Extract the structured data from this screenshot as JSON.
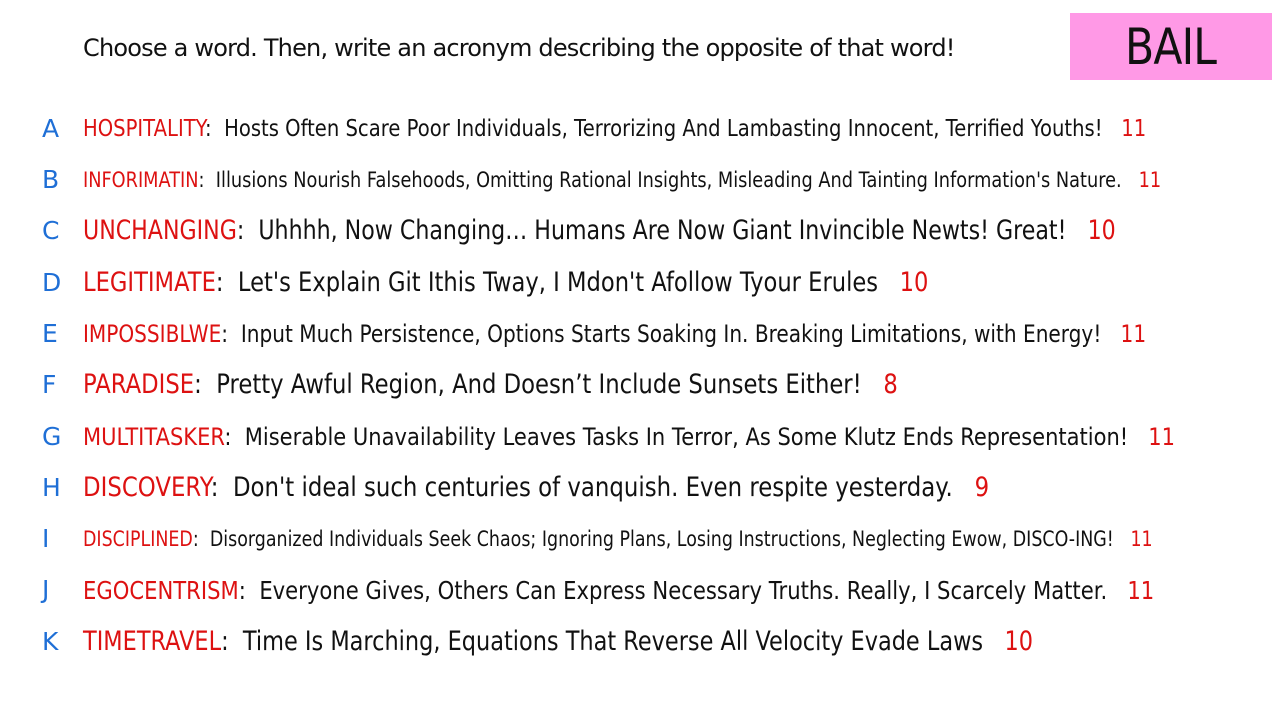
{
  "prompt": "Choose a word. Then, write an acronym describing the opposite of that word!",
  "badge": "BAIL",
  "colors": {
    "letter": "#1f6fd6",
    "word": "#dd1111",
    "count": "#dd1111",
    "badge_bg": "#ff99e6"
  },
  "entries": [
    {
      "letter": "A",
      "word": "HOSPITALITY",
      "acronym": "Hosts Often Scare Poor Individuals, Terrorizing And Lambasting Innocent, Terrified Youths!",
      "count": "11"
    },
    {
      "letter": "B",
      "word": "INFORIMATIN",
      "acronym": "Illusions Nourish Falsehoods, Omitting Rational Insights, Misleading And Tainting Information's Nature.",
      "count": "11"
    },
    {
      "letter": "C",
      "word": "UNCHANGING",
      "acronym": "Uhhhh, Now Changing… Humans Are Now Giant Invincible Newts! Great!",
      "count": "10"
    },
    {
      "letter": "D",
      "word": "LEGITIMATE",
      "acronym": "Let's Explain Git Ithis Tway, I Mdon't Afollow Tyour Erules",
      "count": "10"
    },
    {
      "letter": "E",
      "word": "IMPOSSIBLWE",
      "acronym": "Input Much Persistence, Options Starts Soaking In. Breaking Limitations, with Energy!",
      "count": "11"
    },
    {
      "letter": "F",
      "word": "PARADISE",
      "acronym": "Pretty Awful Region, And Doesn’t Include Sunsets Either!",
      "count": "8"
    },
    {
      "letter": "G",
      "word": "MULTITASKER",
      "acronym": "Miserable Unavailability Leaves Tasks In Terror, As Some Klutz Ends Representation!",
      "count": "11"
    },
    {
      "letter": "H",
      "word": "DISCOVERY",
      "acronym": "Don't ideal such centuries of vanquish. Even respite yesterday.",
      "count": "9"
    },
    {
      "letter": "I",
      "word": "DISCIPLINED",
      "acronym": "Disorganized Individuals Seek Chaos; Ignoring Plans, Losing Instructions, Neglecting Ewow, DISCO-ING!",
      "count": "11"
    },
    {
      "letter": "J",
      "word": "EGOCENTRISM",
      "acronym": "Everyone Gives, Others Can Express Necessary Truths. Really, I Scarcely Matter.",
      "count": "11"
    },
    {
      "letter": "K",
      "word": "TIMETRAVEL",
      "acronym": "Time Is Marching, Equations That Reverse All Velocity Evade Laws",
      "count": "10"
    }
  ]
}
